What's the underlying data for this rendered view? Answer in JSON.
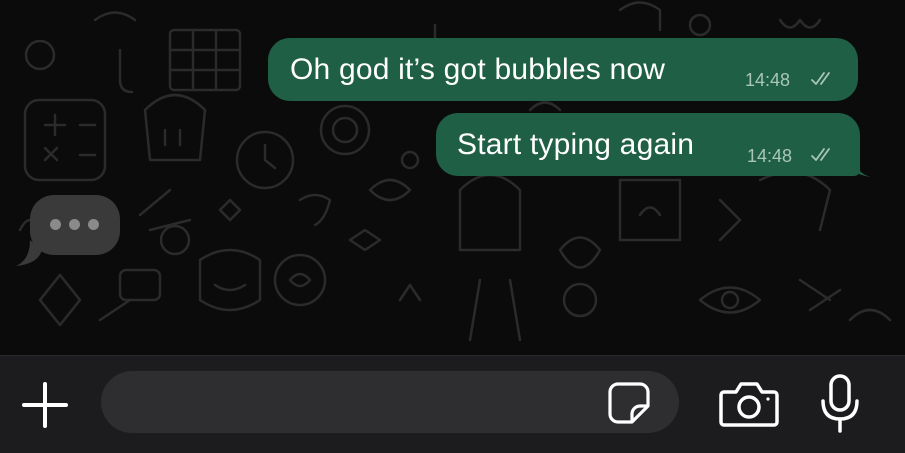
{
  "colors": {
    "chat_background": "#0b0b0b",
    "outgoing_bubble": "#1f5f45",
    "typing_bubble": "#3a3a3a",
    "input_bar": "#1c1c1e",
    "input_field": "#2e2e30",
    "icon": "#ffffff"
  },
  "messages": [
    {
      "text": "Oh god it’s got bubbles now",
      "time": "14:48",
      "status_icon": "double-check-icon"
    },
    {
      "text": "Start typing again",
      "time": "14:48",
      "status_icon": "double-check-icon"
    }
  ],
  "typing_indicator": {
    "icon": "typing-dots-icon"
  },
  "composer": {
    "message_value": "",
    "attach_icon": "plus-icon",
    "sticker_icon": "sticker-icon",
    "camera_icon": "camera-icon",
    "mic_icon": "microphone-icon"
  }
}
